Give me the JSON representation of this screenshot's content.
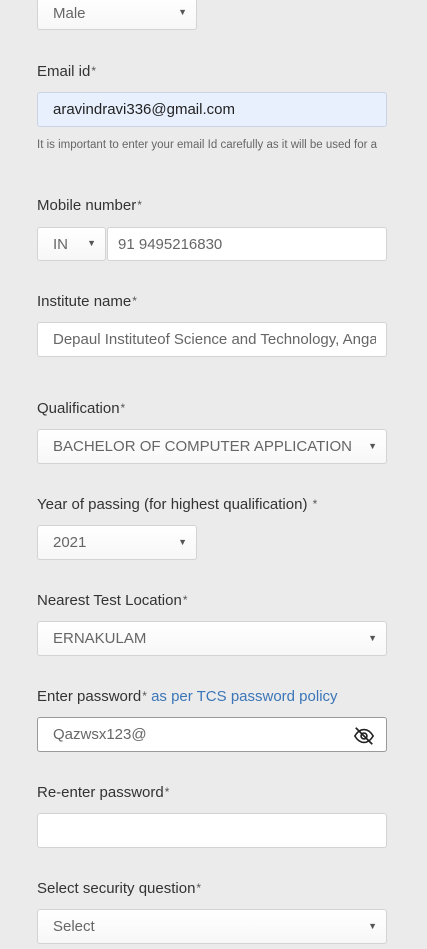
{
  "gender": {
    "value": "Male"
  },
  "email": {
    "label": "Email id",
    "required_mark": "*",
    "value": "aravindravi336@gmail.com",
    "hint": "It is important to enter your email Id carefully as it will be used for a"
  },
  "mobile": {
    "label": "Mobile number",
    "required_mark": "*",
    "country_code": "IN",
    "value": "91 9495216830"
  },
  "institute": {
    "label": "Institute name",
    "required_mark": "*",
    "value": "Depaul Instituteof Science and Technology, Angamaly"
  },
  "qualification": {
    "label": "Qualification",
    "required_mark": "*",
    "value": "BACHELOR OF COMPUTER APPLICATION"
  },
  "year_of_passing": {
    "label": "Year of passing (for highest qualification)",
    "required_mark": "*",
    "value": "2021"
  },
  "test_location": {
    "label": "Nearest Test Location",
    "required_mark": "*",
    "value": "ERNAKULAM"
  },
  "password": {
    "label": "Enter password",
    "required_mark": "*",
    "policy_link": "as per TCS password policy",
    "value": "Qazwsx123@"
  },
  "reenter_password": {
    "label": "Re-enter password",
    "required_mark": "*",
    "value": ""
  },
  "security_question": {
    "label": "Select security question",
    "required_mark": "*",
    "value": "Select"
  },
  "icons": {
    "dropdown": "caret-down-icon",
    "eye": "eye-slash-icon"
  },
  "colors": {
    "link": "#3b76b8",
    "autofill": "#e8f0fe",
    "background": "#ebebeb"
  }
}
